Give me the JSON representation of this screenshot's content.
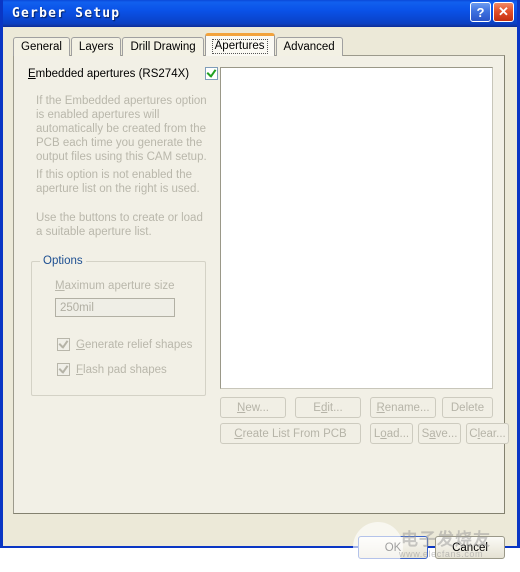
{
  "window": {
    "title": "Gerber Setup",
    "help_button": "?",
    "close_button": "✕"
  },
  "tabs": [
    {
      "label": "General",
      "active": false
    },
    {
      "label": "Layers",
      "active": false
    },
    {
      "label": "Drill Drawing",
      "active": false
    },
    {
      "label": "Apertures",
      "active": true
    },
    {
      "label": "Advanced",
      "active": false
    }
  ],
  "apertures_tab": {
    "embedded_checkbox": {
      "label": "Embedded apertures (RS274X)",
      "accelerator": "E",
      "checked": true,
      "enabled": true
    },
    "description": [
      "If the Embedded apertures option is enabled apertures will automatically be created from the PCB each time you generate the output files using this CAM setup.",
      "If this option is not enabled the aperture list on the right is used.",
      "Use the buttons to create or load a suitable aperture list."
    ],
    "options_group": {
      "title": "Options",
      "max_aperture_label": "Maximum aperture size",
      "max_aperture_accelerator": "M",
      "max_aperture_value": "250mil",
      "max_aperture_enabled": false,
      "checkboxes": [
        {
          "label": "Generate relief shapes",
          "accelerator": "G",
          "checked": true,
          "enabled": false
        },
        {
          "label": "Flash pad shapes",
          "accelerator": "F",
          "checked": true,
          "enabled": false
        }
      ]
    },
    "aperture_list": {
      "items": [],
      "empty": true
    },
    "buttons": [
      {
        "label": "New...",
        "accelerator": "N",
        "enabled": false
      },
      {
        "label": "Edit...",
        "accelerator": "d",
        "enabled": false
      },
      {
        "label": "Rename...",
        "accelerator": "R",
        "enabled": false
      },
      {
        "label": "Delete",
        "accelerator": "",
        "enabled": false
      },
      {
        "label": "Create List From PCB",
        "accelerator": "C",
        "enabled": false
      },
      {
        "label": "Load...",
        "accelerator": "o",
        "enabled": false
      },
      {
        "label": "Save...",
        "accelerator": "a",
        "enabled": false
      },
      {
        "label": "Clear...",
        "accelerator": "l",
        "enabled": false
      }
    ]
  },
  "footer": {
    "ok_label": "OK",
    "cancel_label": "Cancel"
  },
  "watermark": {
    "text_cn": "电子发烧友",
    "url": "www.elecfans.com"
  },
  "colors": {
    "titlebar_blue": "#0a52e8",
    "window_border": "#0a36c4",
    "dialog_face": "#ece9d8",
    "tab_active_accent": "#f2a33c",
    "group_title": "#1d4f91",
    "disabled_text": "#b9b7ab",
    "check_green": "#21a121",
    "default_button_border": "#3a63c8"
  }
}
